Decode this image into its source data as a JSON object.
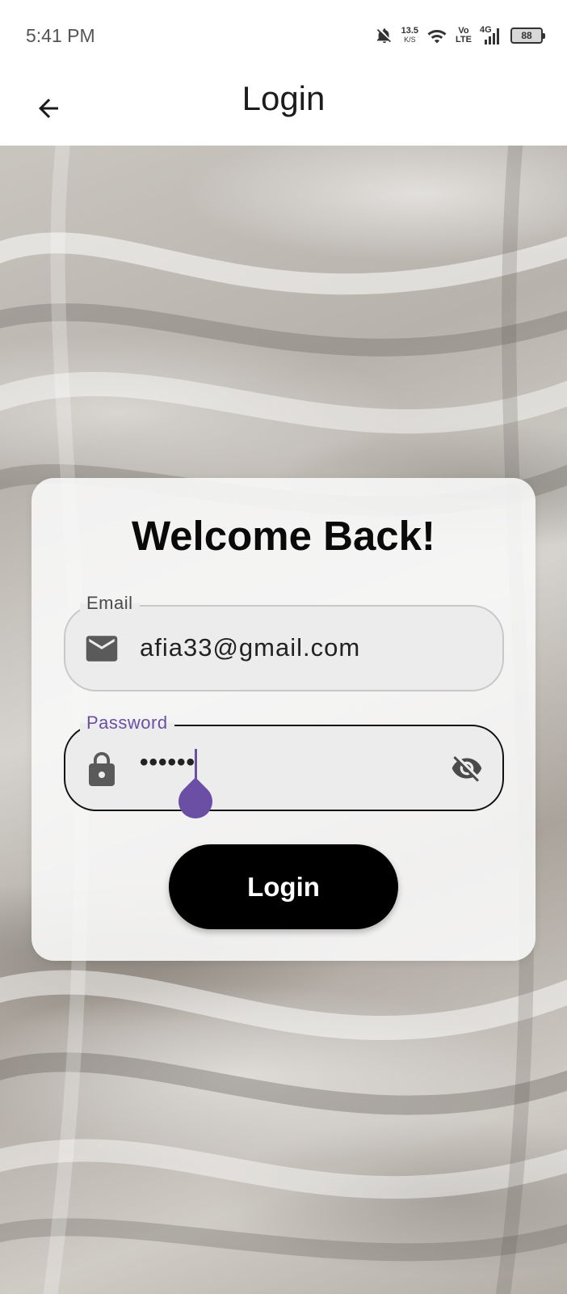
{
  "status_bar": {
    "time": "5:41 PM",
    "net_speed_value": "13.5",
    "net_speed_unit": "K/S",
    "volte_top": "Vo",
    "volte_bottom": "LTE",
    "network_type": "4G",
    "battery_level": "88",
    "icons": [
      "bell-off-icon",
      "wifi-icon",
      "signal-icon",
      "battery-icon"
    ]
  },
  "app_bar": {
    "title": "Login",
    "back_icon": "arrow-left-icon"
  },
  "card": {
    "title": "Welcome Back!",
    "email": {
      "label": "Email",
      "value": "afia33@gmail.com",
      "icon": "mail-icon"
    },
    "password": {
      "label": "Password",
      "value": "••••••",
      "icon": "lock-icon",
      "toggle_icon": "visibility-off-icon"
    },
    "login_button": "Login"
  },
  "colors": {
    "accent": "#6a4fa5",
    "button_bg": "#000000",
    "button_text": "#ffffff",
    "field_bg": "#ececec"
  }
}
